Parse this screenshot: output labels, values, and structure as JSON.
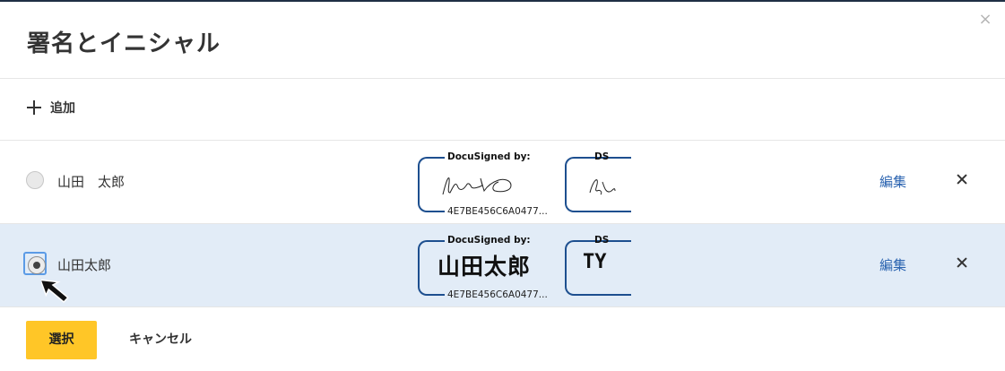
{
  "dialog": {
    "title": "署名とイニシャル",
    "close_icon": "×"
  },
  "toolbar": {
    "add_label": "追加"
  },
  "signatures": [
    {
      "name": "山田　太郎",
      "selected": false,
      "signature_header": "DocuSigned by:",
      "signature_id": "4E7BE456C6A0477...",
      "initials_header": "DS",
      "edit_label": "編集"
    },
    {
      "name": "山田太郎",
      "selected": true,
      "signature_header": "DocuSigned by:",
      "signature_text": "山田太郎",
      "signature_id": "4E7BE456C6A0477...",
      "initials_header": "DS",
      "initials_text": "TY",
      "edit_label": "編集"
    }
  ],
  "footer": {
    "select_label": "選択",
    "cancel_label": "キャンセル"
  },
  "colors": {
    "accent_yellow": "#ffc627",
    "link_blue": "#2a63b0",
    "bracket_blue": "#1d4f8f",
    "selected_row": "#e2ecf7"
  },
  "icons": [
    "close-icon",
    "plus-icon",
    "radio-icon",
    "delete-icon",
    "mouse-cursor-icon"
  ]
}
